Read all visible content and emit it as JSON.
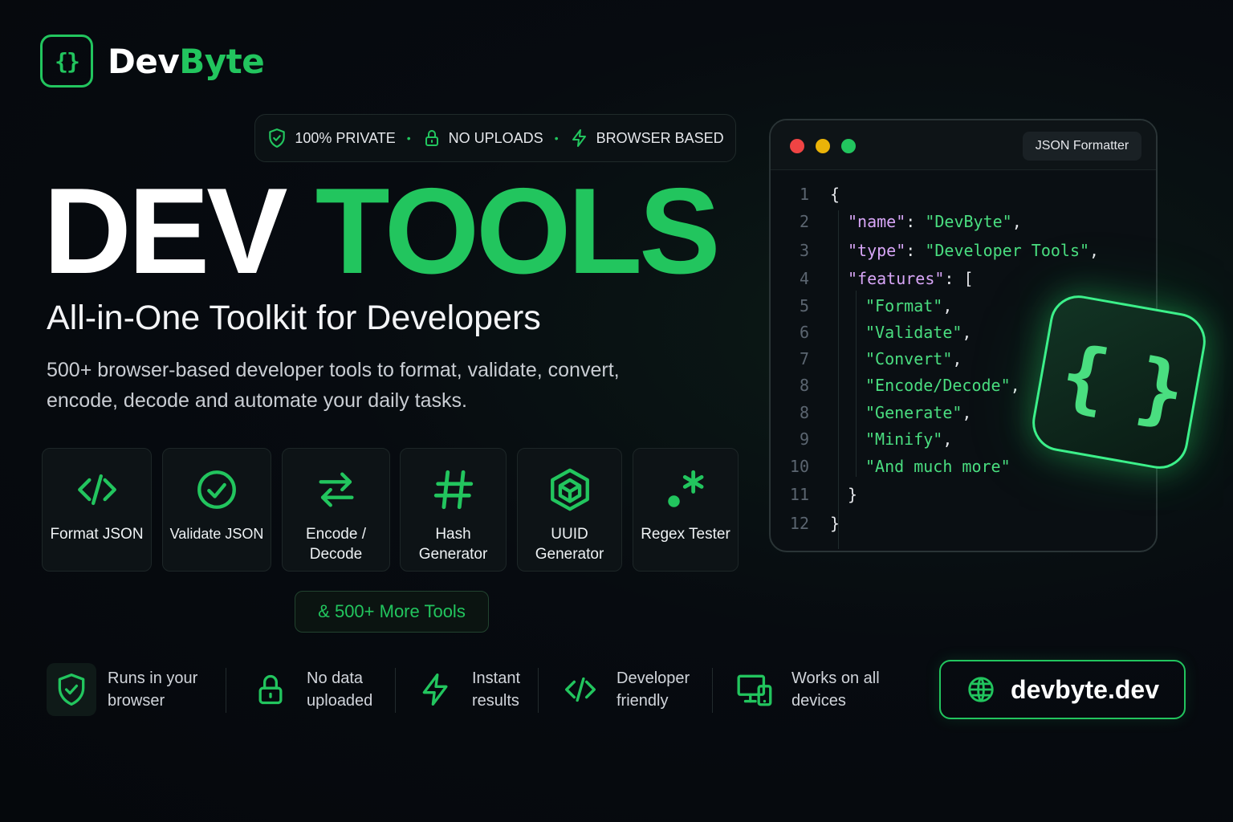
{
  "brand": {
    "left": "Dev",
    "right": "Byte",
    "icon": "curly-braces-icon"
  },
  "badges": [
    {
      "label": "100% PRIVATE",
      "icon": "shield-check-icon"
    },
    {
      "label": "NO UPLOADS",
      "icon": "lock-icon"
    },
    {
      "label": "BROWSER BASED",
      "icon": "lightning-icon"
    }
  ],
  "badge_separator": "•",
  "hero": {
    "word1": "DEV",
    "word2": "TOOLS"
  },
  "subtitle": "All-in-One Toolkit for Developers",
  "description": "500+ browser-based developer tools to format, validate, convert, encode, decode and automate your daily tasks.",
  "tools": [
    {
      "label": "Format JSON",
      "icon": "code-brackets-icon"
    },
    {
      "label": "Validate JSON",
      "icon": "check-circle-icon"
    },
    {
      "label": "Encode / Decode",
      "icon": "swap-arrows-icon"
    },
    {
      "label": "Hash Generator",
      "icon": "hash-icon"
    },
    {
      "label": "UUID Generator",
      "icon": "cube-icon"
    },
    {
      "label": "Regex Tester",
      "icon": "regex-icon"
    }
  ],
  "more_tools_label": "& 500+ More Tools",
  "features": [
    {
      "label": "Runs in your browser",
      "icon": "shield-check-icon"
    },
    {
      "label": "No data uploaded",
      "icon": "lock-icon"
    },
    {
      "label": "Instant results",
      "icon": "lightning-icon"
    },
    {
      "label": "Developer friendly",
      "icon": "code-brackets-icon"
    },
    {
      "label": "Works on all devices",
      "icon": "devices-icon"
    }
  ],
  "site": {
    "label": "devbyte.dev",
    "icon": "globe-icon"
  },
  "editor": {
    "tab_label": "JSON Formatter",
    "line_numbers": [
      "1",
      "2",
      "3",
      "4",
      "5",
      "6",
      "7",
      "8",
      "8",
      "9",
      "10",
      "11",
      "12"
    ],
    "lines": [
      "{",
      "\"name\": \"DevByte\",",
      "\"type\": \"Developer Tools\",",
      "\"features\": [",
      "\"Format\",",
      "\"Validate\",",
      "\"Convert\",",
      "\"Encode/Decode\",",
      "\"Generate\",",
      "\"Minify\",",
      "\"And much more\"",
      "}",
      "}"
    ],
    "colors": {
      "key": "#d8a6f7",
      "string": "#4ade80",
      "close": "#ef4444",
      "minimize": "#eab308",
      "maximize": "#22c55e"
    }
  },
  "floating_tile_icon": "curly-braces-icon",
  "accent_color": "#22c55e"
}
